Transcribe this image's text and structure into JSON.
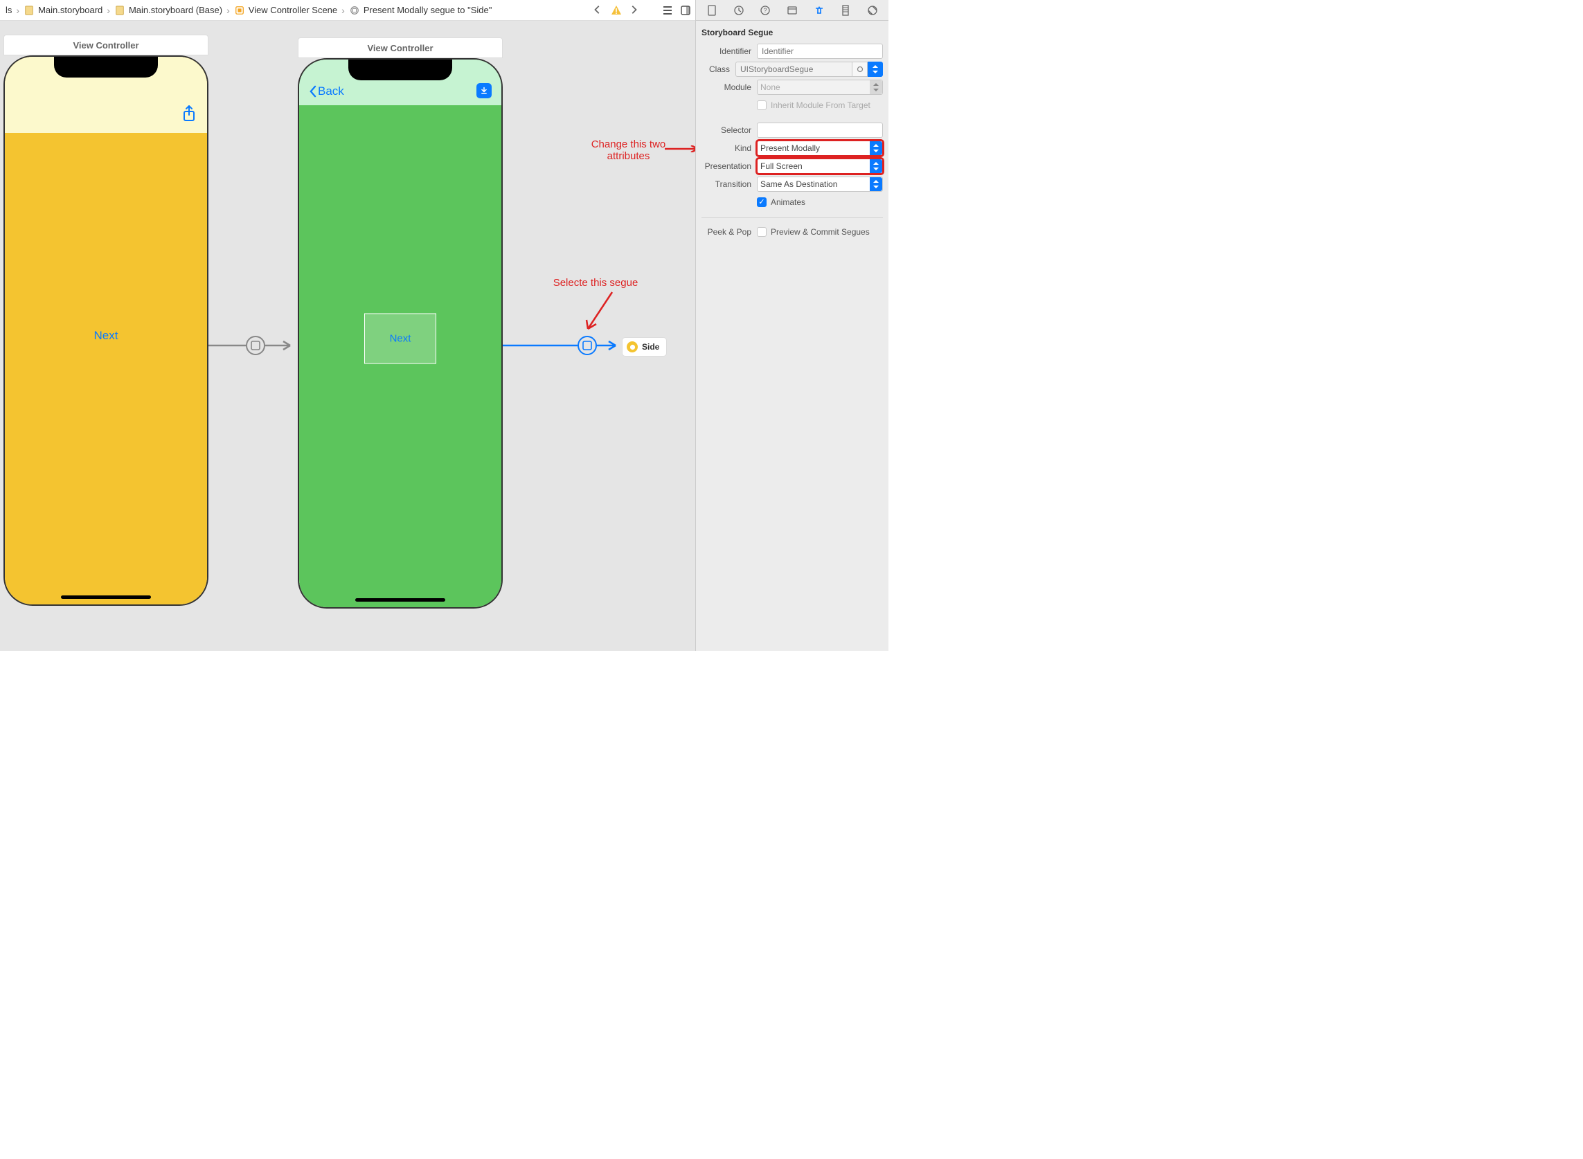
{
  "pathbar": {
    "items": [
      {
        "label": "ls",
        "icon": "none"
      },
      {
        "label": "Main.storyboard",
        "icon": "storyboard-file-icon"
      },
      {
        "label": "Main.storyboard (Base)",
        "icon": "storyboard-file-icon"
      },
      {
        "label": "View Controller Scene",
        "icon": "scene-icon"
      },
      {
        "label": "Present Modally segue to \"Side\"",
        "icon": "segue-icon"
      }
    ]
  },
  "scenes": {
    "first": {
      "title": "View Controller",
      "button_label": "Next"
    },
    "second": {
      "title": "View Controller",
      "back_label": "Back",
      "button_label": "Next"
    },
    "side_chip_label": "Side"
  },
  "annotations": {
    "change_attrs": "Change this two attributes",
    "select_segue": "Selecte this segue"
  },
  "inspector": {
    "section_title": "Storyboard Segue",
    "rows": {
      "identifier": {
        "label": "Identifier",
        "placeholder": "Identifier",
        "value": ""
      },
      "class": {
        "label": "Class",
        "placeholder": "UIStoryboardSegue",
        "value": ""
      },
      "module": {
        "label": "Module",
        "placeholder": "None",
        "value": ""
      },
      "inherit": {
        "label": "Inherit Module From Target",
        "checked": false
      },
      "selector": {
        "label": "Selector",
        "value": ""
      },
      "kind": {
        "label": "Kind",
        "value": "Present Modally"
      },
      "presentation": {
        "label": "Presentation",
        "value": "Full Screen"
      },
      "transition": {
        "label": "Transition",
        "value": "Same As Destination"
      },
      "animates": {
        "label": "Animates",
        "checked": true
      }
    },
    "peek": {
      "label": "Peek & Pop",
      "option": "Preview & Commit Segues",
      "checked": false
    }
  }
}
